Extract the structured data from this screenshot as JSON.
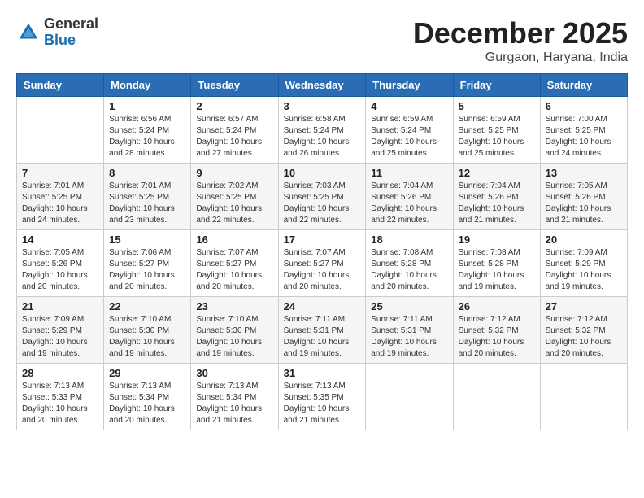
{
  "header": {
    "logo_general": "General",
    "logo_blue": "Blue",
    "month_title": "December 2025",
    "location": "Gurgaon, Haryana, India"
  },
  "days_of_week": [
    "Sunday",
    "Monday",
    "Tuesday",
    "Wednesday",
    "Thursday",
    "Friday",
    "Saturday"
  ],
  "weeks": [
    [
      {
        "day": "",
        "sunrise": "",
        "sunset": "",
        "daylight": ""
      },
      {
        "day": "1",
        "sunrise": "Sunrise: 6:56 AM",
        "sunset": "Sunset: 5:24 PM",
        "daylight": "Daylight: 10 hours and 28 minutes."
      },
      {
        "day": "2",
        "sunrise": "Sunrise: 6:57 AM",
        "sunset": "Sunset: 5:24 PM",
        "daylight": "Daylight: 10 hours and 27 minutes."
      },
      {
        "day": "3",
        "sunrise": "Sunrise: 6:58 AM",
        "sunset": "Sunset: 5:24 PM",
        "daylight": "Daylight: 10 hours and 26 minutes."
      },
      {
        "day": "4",
        "sunrise": "Sunrise: 6:59 AM",
        "sunset": "Sunset: 5:24 PM",
        "daylight": "Daylight: 10 hours and 25 minutes."
      },
      {
        "day": "5",
        "sunrise": "Sunrise: 6:59 AM",
        "sunset": "Sunset: 5:25 PM",
        "daylight": "Daylight: 10 hours and 25 minutes."
      },
      {
        "day": "6",
        "sunrise": "Sunrise: 7:00 AM",
        "sunset": "Sunset: 5:25 PM",
        "daylight": "Daylight: 10 hours and 24 minutes."
      }
    ],
    [
      {
        "day": "7",
        "sunrise": "Sunrise: 7:01 AM",
        "sunset": "Sunset: 5:25 PM",
        "daylight": "Daylight: 10 hours and 24 minutes."
      },
      {
        "day": "8",
        "sunrise": "Sunrise: 7:01 AM",
        "sunset": "Sunset: 5:25 PM",
        "daylight": "Daylight: 10 hours and 23 minutes."
      },
      {
        "day": "9",
        "sunrise": "Sunrise: 7:02 AM",
        "sunset": "Sunset: 5:25 PM",
        "daylight": "Daylight: 10 hours and 22 minutes."
      },
      {
        "day": "10",
        "sunrise": "Sunrise: 7:03 AM",
        "sunset": "Sunset: 5:25 PM",
        "daylight": "Daylight: 10 hours and 22 minutes."
      },
      {
        "day": "11",
        "sunrise": "Sunrise: 7:04 AM",
        "sunset": "Sunset: 5:26 PM",
        "daylight": "Daylight: 10 hours and 22 minutes."
      },
      {
        "day": "12",
        "sunrise": "Sunrise: 7:04 AM",
        "sunset": "Sunset: 5:26 PM",
        "daylight": "Daylight: 10 hours and 21 minutes."
      },
      {
        "day": "13",
        "sunrise": "Sunrise: 7:05 AM",
        "sunset": "Sunset: 5:26 PM",
        "daylight": "Daylight: 10 hours and 21 minutes."
      }
    ],
    [
      {
        "day": "14",
        "sunrise": "Sunrise: 7:05 AM",
        "sunset": "Sunset: 5:26 PM",
        "daylight": "Daylight: 10 hours and 20 minutes."
      },
      {
        "day": "15",
        "sunrise": "Sunrise: 7:06 AM",
        "sunset": "Sunset: 5:27 PM",
        "daylight": "Daylight: 10 hours and 20 minutes."
      },
      {
        "day": "16",
        "sunrise": "Sunrise: 7:07 AM",
        "sunset": "Sunset: 5:27 PM",
        "daylight": "Daylight: 10 hours and 20 minutes."
      },
      {
        "day": "17",
        "sunrise": "Sunrise: 7:07 AM",
        "sunset": "Sunset: 5:27 PM",
        "daylight": "Daylight: 10 hours and 20 minutes."
      },
      {
        "day": "18",
        "sunrise": "Sunrise: 7:08 AM",
        "sunset": "Sunset: 5:28 PM",
        "daylight": "Daylight: 10 hours and 20 minutes."
      },
      {
        "day": "19",
        "sunrise": "Sunrise: 7:08 AM",
        "sunset": "Sunset: 5:28 PM",
        "daylight": "Daylight: 10 hours and 19 minutes."
      },
      {
        "day": "20",
        "sunrise": "Sunrise: 7:09 AM",
        "sunset": "Sunset: 5:29 PM",
        "daylight": "Daylight: 10 hours and 19 minutes."
      }
    ],
    [
      {
        "day": "21",
        "sunrise": "Sunrise: 7:09 AM",
        "sunset": "Sunset: 5:29 PM",
        "daylight": "Daylight: 10 hours and 19 minutes."
      },
      {
        "day": "22",
        "sunrise": "Sunrise: 7:10 AM",
        "sunset": "Sunset: 5:30 PM",
        "daylight": "Daylight: 10 hours and 19 minutes."
      },
      {
        "day": "23",
        "sunrise": "Sunrise: 7:10 AM",
        "sunset": "Sunset: 5:30 PM",
        "daylight": "Daylight: 10 hours and 19 minutes."
      },
      {
        "day": "24",
        "sunrise": "Sunrise: 7:11 AM",
        "sunset": "Sunset: 5:31 PM",
        "daylight": "Daylight: 10 hours and 19 minutes."
      },
      {
        "day": "25",
        "sunrise": "Sunrise: 7:11 AM",
        "sunset": "Sunset: 5:31 PM",
        "daylight": "Daylight: 10 hours and 19 minutes."
      },
      {
        "day": "26",
        "sunrise": "Sunrise: 7:12 AM",
        "sunset": "Sunset: 5:32 PM",
        "daylight": "Daylight: 10 hours and 20 minutes."
      },
      {
        "day": "27",
        "sunrise": "Sunrise: 7:12 AM",
        "sunset": "Sunset: 5:32 PM",
        "daylight": "Daylight: 10 hours and 20 minutes."
      }
    ],
    [
      {
        "day": "28",
        "sunrise": "Sunrise: 7:13 AM",
        "sunset": "Sunset: 5:33 PM",
        "daylight": "Daylight: 10 hours and 20 minutes."
      },
      {
        "day": "29",
        "sunrise": "Sunrise: 7:13 AM",
        "sunset": "Sunset: 5:34 PM",
        "daylight": "Daylight: 10 hours and 20 minutes."
      },
      {
        "day": "30",
        "sunrise": "Sunrise: 7:13 AM",
        "sunset": "Sunset: 5:34 PM",
        "daylight": "Daylight: 10 hours and 21 minutes."
      },
      {
        "day": "31",
        "sunrise": "Sunrise: 7:13 AM",
        "sunset": "Sunset: 5:35 PM",
        "daylight": "Daylight: 10 hours and 21 minutes."
      },
      {
        "day": "",
        "sunrise": "",
        "sunset": "",
        "daylight": ""
      },
      {
        "day": "",
        "sunrise": "",
        "sunset": "",
        "daylight": ""
      },
      {
        "day": "",
        "sunrise": "",
        "sunset": "",
        "daylight": ""
      }
    ]
  ]
}
